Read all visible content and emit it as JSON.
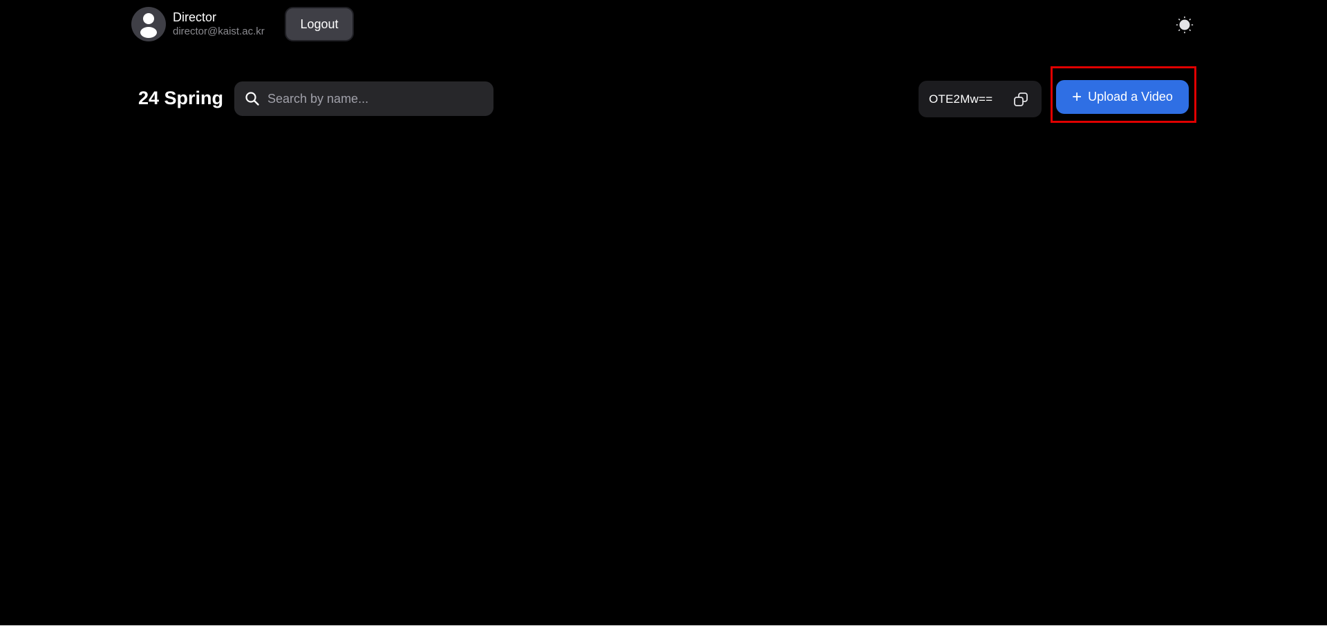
{
  "header": {
    "user": {
      "name": "Director",
      "email": "director@kaist.ac.kr",
      "avatar_icon": "user-avatar-icon"
    },
    "logout_label": "Logout",
    "theme_toggle_icon": "sun-icon"
  },
  "toolbar": {
    "course_title": "24 Spring",
    "search": {
      "placeholder": "Search by name...",
      "value": "",
      "icon": "search-icon"
    },
    "invite_code": {
      "value": "OTE2Mw==",
      "copy_icon": "copy-icon"
    },
    "upload_button": {
      "plus": "+",
      "label": "Upload a Video",
      "color": "#2f6fe4"
    }
  },
  "colors": {
    "background": "#000000",
    "highlight": "#e00000",
    "surface": "#27272a"
  }
}
